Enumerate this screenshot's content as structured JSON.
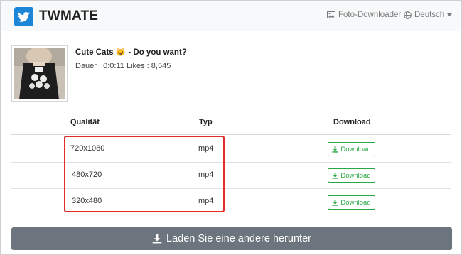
{
  "header": {
    "brand": "TWMATE",
    "photo_downloader": "Foto-Downloader",
    "language": "Deutsch"
  },
  "video": {
    "title": "Cute Cats 😺 - Do you want?",
    "meta": "Dauer : 0:0:11 Likes : 8,545"
  },
  "table": {
    "headers": [
      "Qualität",
      "Typ",
      "Download"
    ],
    "rows": [
      {
        "quality": "720x1080",
        "type": "mp4",
        "download": "Download"
      },
      {
        "quality": "480x720",
        "type": "mp4",
        "download": "Download"
      },
      {
        "quality": "320x480",
        "type": "mp4",
        "download": "Download"
      }
    ]
  },
  "actions": {
    "download_another": "Laden Sie eine andere herunter"
  },
  "colors": {
    "brand_blue": "#1e86d6",
    "success_green": "#28a745",
    "secondary_gray": "#6c757d",
    "highlight_red": "#e32b2b"
  }
}
